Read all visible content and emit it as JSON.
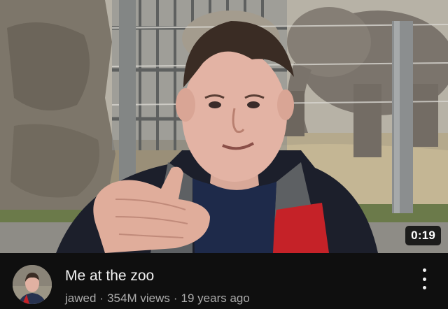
{
  "video": {
    "title": "Me at the zoo",
    "duration": "0:19",
    "channel": "jawed",
    "views": "354M views",
    "age": "19 years ago",
    "separator": "·"
  },
  "icons": {
    "more": "more-vert-icon",
    "avatar": "channel-avatar"
  },
  "colors": {
    "background": "#0f0f0f",
    "title_text": "#f1f1f1",
    "secondary_text": "#aaaaaa",
    "duration_badge": "#000000"
  }
}
